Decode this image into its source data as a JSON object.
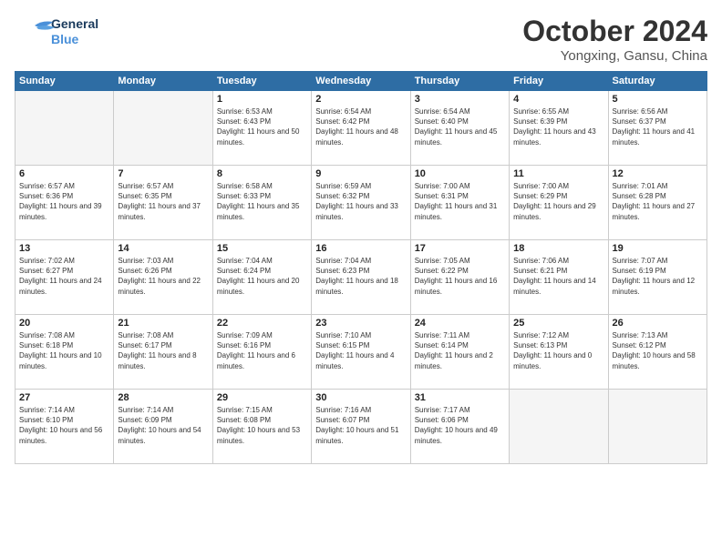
{
  "header": {
    "logo_general": "General",
    "logo_blue": "Blue",
    "month_title": "October 2024",
    "location": "Yongxing, Gansu, China"
  },
  "weekdays": [
    "Sunday",
    "Monday",
    "Tuesday",
    "Wednesday",
    "Thursday",
    "Friday",
    "Saturday"
  ],
  "weeks": [
    [
      {
        "day": "",
        "sunrise": "",
        "sunset": "",
        "daylight": ""
      },
      {
        "day": "",
        "sunrise": "",
        "sunset": "",
        "daylight": ""
      },
      {
        "day": "1",
        "sunrise": "Sunrise: 6:53 AM",
        "sunset": "Sunset: 6:43 PM",
        "daylight": "Daylight: 11 hours and 50 minutes."
      },
      {
        "day": "2",
        "sunrise": "Sunrise: 6:54 AM",
        "sunset": "Sunset: 6:42 PM",
        "daylight": "Daylight: 11 hours and 48 minutes."
      },
      {
        "day": "3",
        "sunrise": "Sunrise: 6:54 AM",
        "sunset": "Sunset: 6:40 PM",
        "daylight": "Daylight: 11 hours and 45 minutes."
      },
      {
        "day": "4",
        "sunrise": "Sunrise: 6:55 AM",
        "sunset": "Sunset: 6:39 PM",
        "daylight": "Daylight: 11 hours and 43 minutes."
      },
      {
        "day": "5",
        "sunrise": "Sunrise: 6:56 AM",
        "sunset": "Sunset: 6:37 PM",
        "daylight": "Daylight: 11 hours and 41 minutes."
      }
    ],
    [
      {
        "day": "6",
        "sunrise": "Sunrise: 6:57 AM",
        "sunset": "Sunset: 6:36 PM",
        "daylight": "Daylight: 11 hours and 39 minutes."
      },
      {
        "day": "7",
        "sunrise": "Sunrise: 6:57 AM",
        "sunset": "Sunset: 6:35 PM",
        "daylight": "Daylight: 11 hours and 37 minutes."
      },
      {
        "day": "8",
        "sunrise": "Sunrise: 6:58 AM",
        "sunset": "Sunset: 6:33 PM",
        "daylight": "Daylight: 11 hours and 35 minutes."
      },
      {
        "day": "9",
        "sunrise": "Sunrise: 6:59 AM",
        "sunset": "Sunset: 6:32 PM",
        "daylight": "Daylight: 11 hours and 33 minutes."
      },
      {
        "day": "10",
        "sunrise": "Sunrise: 7:00 AM",
        "sunset": "Sunset: 6:31 PM",
        "daylight": "Daylight: 11 hours and 31 minutes."
      },
      {
        "day": "11",
        "sunrise": "Sunrise: 7:00 AM",
        "sunset": "Sunset: 6:29 PM",
        "daylight": "Daylight: 11 hours and 29 minutes."
      },
      {
        "day": "12",
        "sunrise": "Sunrise: 7:01 AM",
        "sunset": "Sunset: 6:28 PM",
        "daylight": "Daylight: 11 hours and 27 minutes."
      }
    ],
    [
      {
        "day": "13",
        "sunrise": "Sunrise: 7:02 AM",
        "sunset": "Sunset: 6:27 PM",
        "daylight": "Daylight: 11 hours and 24 minutes."
      },
      {
        "day": "14",
        "sunrise": "Sunrise: 7:03 AM",
        "sunset": "Sunset: 6:26 PM",
        "daylight": "Daylight: 11 hours and 22 minutes."
      },
      {
        "day": "15",
        "sunrise": "Sunrise: 7:04 AM",
        "sunset": "Sunset: 6:24 PM",
        "daylight": "Daylight: 11 hours and 20 minutes."
      },
      {
        "day": "16",
        "sunrise": "Sunrise: 7:04 AM",
        "sunset": "Sunset: 6:23 PM",
        "daylight": "Daylight: 11 hours and 18 minutes."
      },
      {
        "day": "17",
        "sunrise": "Sunrise: 7:05 AM",
        "sunset": "Sunset: 6:22 PM",
        "daylight": "Daylight: 11 hours and 16 minutes."
      },
      {
        "day": "18",
        "sunrise": "Sunrise: 7:06 AM",
        "sunset": "Sunset: 6:21 PM",
        "daylight": "Daylight: 11 hours and 14 minutes."
      },
      {
        "day": "19",
        "sunrise": "Sunrise: 7:07 AM",
        "sunset": "Sunset: 6:19 PM",
        "daylight": "Daylight: 11 hours and 12 minutes."
      }
    ],
    [
      {
        "day": "20",
        "sunrise": "Sunrise: 7:08 AM",
        "sunset": "Sunset: 6:18 PM",
        "daylight": "Daylight: 11 hours and 10 minutes."
      },
      {
        "day": "21",
        "sunrise": "Sunrise: 7:08 AM",
        "sunset": "Sunset: 6:17 PM",
        "daylight": "Daylight: 11 hours and 8 minutes."
      },
      {
        "day": "22",
        "sunrise": "Sunrise: 7:09 AM",
        "sunset": "Sunset: 6:16 PM",
        "daylight": "Daylight: 11 hours and 6 minutes."
      },
      {
        "day": "23",
        "sunrise": "Sunrise: 7:10 AM",
        "sunset": "Sunset: 6:15 PM",
        "daylight": "Daylight: 11 hours and 4 minutes."
      },
      {
        "day": "24",
        "sunrise": "Sunrise: 7:11 AM",
        "sunset": "Sunset: 6:14 PM",
        "daylight": "Daylight: 11 hours and 2 minutes."
      },
      {
        "day": "25",
        "sunrise": "Sunrise: 7:12 AM",
        "sunset": "Sunset: 6:13 PM",
        "daylight": "Daylight: 11 hours and 0 minutes."
      },
      {
        "day": "26",
        "sunrise": "Sunrise: 7:13 AM",
        "sunset": "Sunset: 6:12 PM",
        "daylight": "Daylight: 10 hours and 58 minutes."
      }
    ],
    [
      {
        "day": "27",
        "sunrise": "Sunrise: 7:14 AM",
        "sunset": "Sunset: 6:10 PM",
        "daylight": "Daylight: 10 hours and 56 minutes."
      },
      {
        "day": "28",
        "sunrise": "Sunrise: 7:14 AM",
        "sunset": "Sunset: 6:09 PM",
        "daylight": "Daylight: 10 hours and 54 minutes."
      },
      {
        "day": "29",
        "sunrise": "Sunrise: 7:15 AM",
        "sunset": "Sunset: 6:08 PM",
        "daylight": "Daylight: 10 hours and 53 minutes."
      },
      {
        "day": "30",
        "sunrise": "Sunrise: 7:16 AM",
        "sunset": "Sunset: 6:07 PM",
        "daylight": "Daylight: 10 hours and 51 minutes."
      },
      {
        "day": "31",
        "sunrise": "Sunrise: 7:17 AM",
        "sunset": "Sunset: 6:06 PM",
        "daylight": "Daylight: 10 hours and 49 minutes."
      },
      {
        "day": "",
        "sunrise": "",
        "sunset": "",
        "daylight": ""
      },
      {
        "day": "",
        "sunrise": "",
        "sunset": "",
        "daylight": ""
      }
    ]
  ]
}
